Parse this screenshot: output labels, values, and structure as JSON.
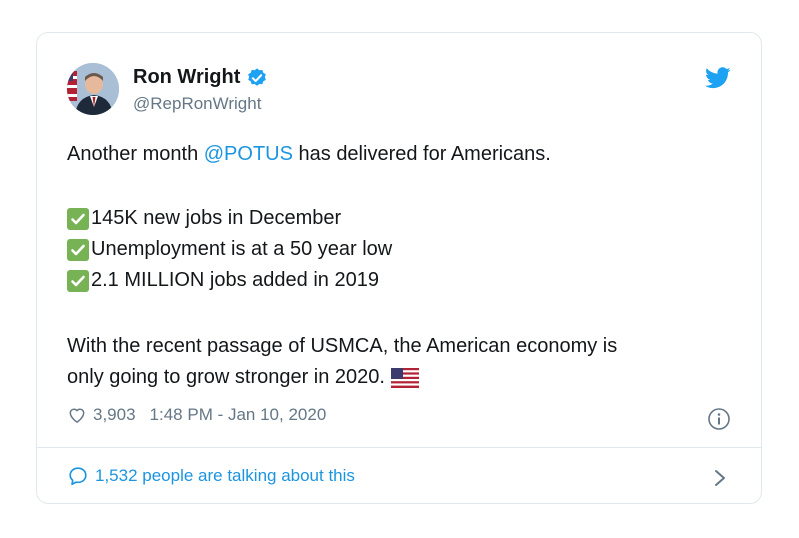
{
  "tweet": {
    "author_name": "Ron Wright",
    "handle": "@RepRonWright",
    "line1_before": "Another month ",
    "mention": "@POTUS",
    "line1_after": " has delivered for Americans.",
    "checklist": [
      "145K new jobs in December",
      "Unemployment is at a 50 year low",
      "2.1 MILLION jobs added in 2019"
    ],
    "closing_line1": "With the recent passage of USMCA, the American economy is",
    "closing_line2": "only going to grow stronger in 2020.",
    "likes": "3,903",
    "timestamp": "1:48 PM - Jan 10, 2020",
    "talking": "1,532 people are talking about this"
  },
  "colors": {
    "accent": "#1b95e0",
    "text": "#14171a",
    "muted": "#657786",
    "check": "#77b255",
    "border": "#e1e8ed"
  },
  "icons": [
    "verified-badge-icon",
    "twitter-bird-icon",
    "heart-icon",
    "info-icon",
    "speech-bubble-icon",
    "chevron-right-icon",
    "check-mark-icon",
    "us-flag-icon"
  ]
}
